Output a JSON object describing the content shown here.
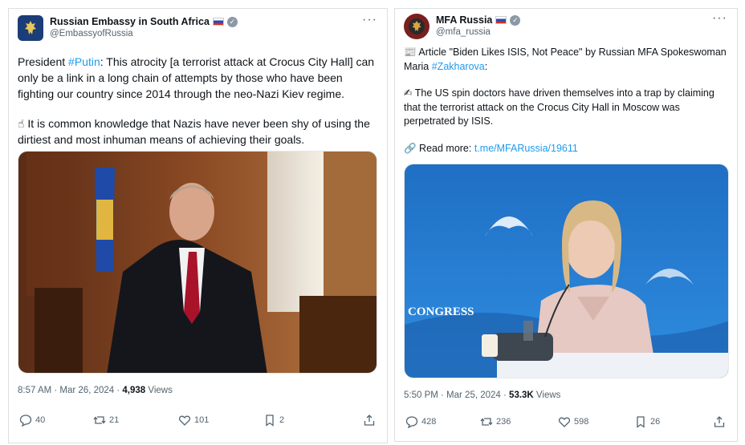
{
  "tweets": [
    {
      "author": {
        "name": "Russian Embassy in South Africa",
        "handle": "@EmbassyofRussia"
      },
      "text": {
        "p1_pre": "President ",
        "p1_tag": "#Putin",
        "p1_post": ": This atrocity [a terrorist attack at Crocus City Hall] can only be a link in a long chain of attempts by those who have been fighting our country since 2014 through the neo-Nazi Kiev regime.",
        "p2_emoji": "☝",
        "p2": " It is common knowledge that Nazis have never been shy of using the dirtiest and most inhuman means of achieving their goals."
      },
      "timestamp": "8:57 AM · Mar 26, 2024 · ",
      "views_count": "4,938",
      "views_label": " Views",
      "stats": {
        "replies": "40",
        "reposts": "21",
        "likes": "101",
        "bookmarks": "2"
      }
    },
    {
      "author": {
        "name": "MFA Russia",
        "handle": "@mfa_russia"
      },
      "text": {
        "p1_emoji": "📰",
        "p1_pre": " Article \"Biden Likes ISIS, Not Peace\" by Russian MFA Spokeswoman Maria ",
        "p1_tag": "#Zakharova",
        "p1_post": ":",
        "p2_emoji": "✍",
        "p2": " The US spin doctors have driven themselves into a trap by claiming that the terrorist attack on the Crocus City Hall in Moscow was perpetrated by ISIS.",
        "p3_emoji": "🔗",
        "p3_pre": " Read more: ",
        "p3_link": "t.me/MFARussia/19611"
      },
      "media_text": "CONGRESS",
      "timestamp": "5:50 PM · Mar 25, 2024 · ",
      "views_count": "53.3K",
      "views_label": " Views",
      "stats": {
        "replies": "428",
        "reposts": "236",
        "likes": "598",
        "bookmarks": "26"
      }
    }
  ],
  "icons": {
    "verified": "verified-badge-icon",
    "flag": "russia-flag-icon",
    "more": "more-icon",
    "reply": "reply-icon",
    "repost": "repost-icon",
    "like": "like-icon",
    "bookmark": "bookmark-icon",
    "share": "share-icon"
  },
  "colors": {
    "link": "#1d9bf0",
    "muted": "#536471",
    "text": "#0f1419"
  }
}
